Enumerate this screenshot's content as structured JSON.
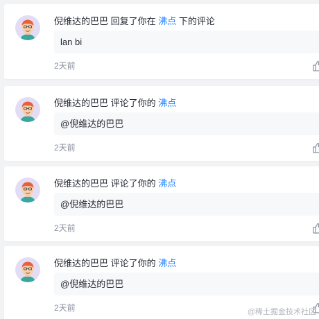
{
  "notifications": [
    {
      "user": "倪维达的巴巴",
      "action": "回复了你在",
      "target": "沸点",
      "suffix": "下的评论",
      "content": "lan bi",
      "time": "2天前"
    },
    {
      "user": "倪维达的巴巴",
      "action": "评论了你的",
      "target": "沸点",
      "suffix": "",
      "content": "@倪维达的巴巴",
      "time": "2天前"
    },
    {
      "user": "倪维达的巴巴",
      "action": "评论了你的",
      "target": "沸点",
      "suffix": "",
      "content": "@倪维达的巴巴",
      "time": "2天前"
    },
    {
      "user": "倪维达的巴巴",
      "action": "评论了你的",
      "target": "沸点",
      "suffix": "",
      "content": "@倪维达的巴巴",
      "time": "2天前"
    }
  ],
  "watermark": "@稀土掘金技术社区",
  "colors": {
    "link": "#1e80ff",
    "avatar_bg": "#e3dcf5"
  },
  "icons": {
    "avatar": "cartoon-avatar-icon",
    "like": "thumb-up-icon"
  }
}
